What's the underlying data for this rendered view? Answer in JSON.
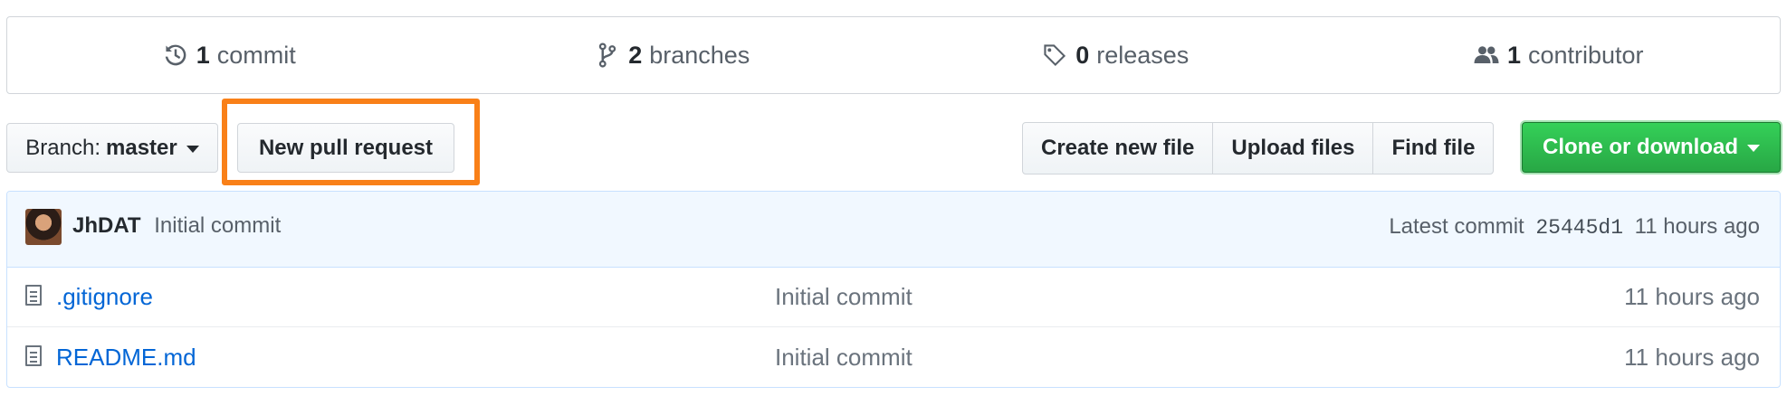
{
  "summary": {
    "commits": {
      "count": "1",
      "label": "commit",
      "icon": "history-icon"
    },
    "branches": {
      "count": "2",
      "label": "branches",
      "icon": "branch-icon"
    },
    "releases": {
      "count": "0",
      "label": "releases",
      "icon": "tag-icon"
    },
    "contributors": {
      "count": "1",
      "label": "contributor",
      "icon": "people-icon"
    }
  },
  "toolbar": {
    "branch_prefix": "Branch:",
    "branch_name": "master",
    "new_pull_request": "New pull request",
    "create_new_file": "Create new file",
    "upload_files": "Upload files",
    "find_file": "Find file",
    "clone_or_download": "Clone or download"
  },
  "latest_commit": {
    "author": "JhDAT",
    "message": "Initial commit",
    "prefix": "Latest commit",
    "sha": "25445d1",
    "age": "11 hours ago"
  },
  "files": [
    {
      "name": ".gitignore",
      "message": "Initial commit",
      "age": "11 hours ago"
    },
    {
      "name": "README.md",
      "message": "Initial commit",
      "age": "11 hours ago"
    }
  ],
  "colors": {
    "highlight": "#f98018",
    "primary": "#28a745",
    "link": "#0366d6"
  }
}
